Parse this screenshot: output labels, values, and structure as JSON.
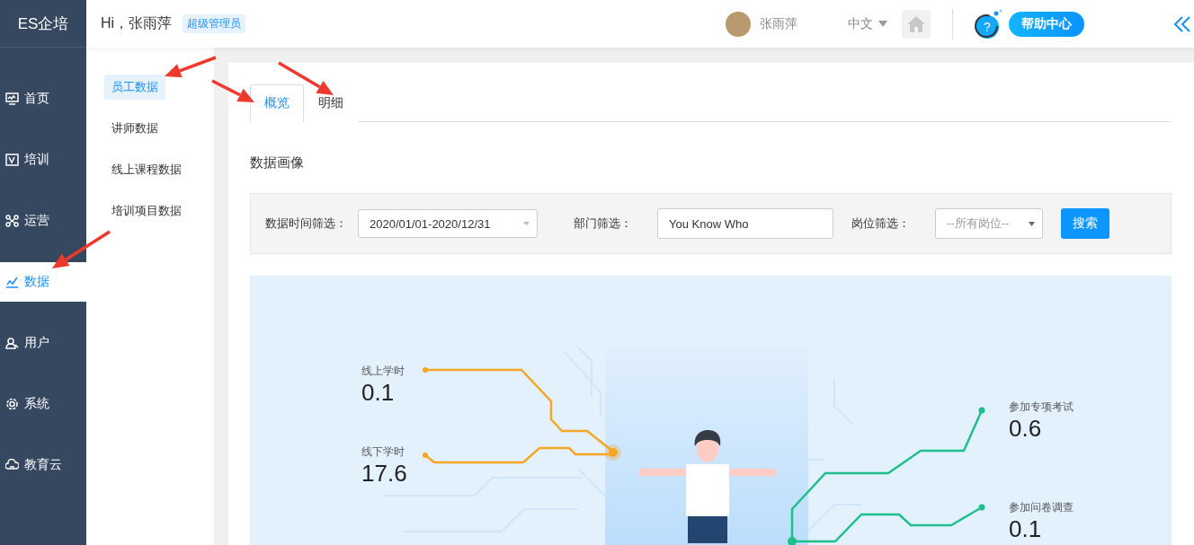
{
  "header": {
    "logo": "ES企培",
    "greeting": "Hi，张雨萍",
    "role_badge": "超级管理员",
    "user_name": "张雨萍",
    "language": "中文",
    "help": "帮助中心",
    "help_icon": "?"
  },
  "nav": [
    {
      "label": "首页",
      "selected": false
    },
    {
      "label": "培训",
      "selected": false
    },
    {
      "label": "运营",
      "selected": false
    },
    {
      "label": "数据",
      "selected": true
    },
    {
      "label": "用户",
      "selected": false
    },
    {
      "label": "系统",
      "selected": false
    },
    {
      "label": "教育云",
      "selected": false
    }
  ],
  "subnav": [
    {
      "label": "员工数据",
      "selected": true
    },
    {
      "label": "讲师数据",
      "selected": false
    },
    {
      "label": "线上课程数据",
      "selected": false
    },
    {
      "label": "培训项目数据",
      "selected": false
    }
  ],
  "tabs": [
    {
      "label": "概览",
      "selected": true
    },
    {
      "label": "明细",
      "selected": false
    }
  ],
  "section_title": "数据画像",
  "filters": {
    "date_label": "数据时间筛选：",
    "date_value": "2020/01/01-2020/12/31",
    "dept_label": "部门筛选：",
    "dept_value": "You Know Who",
    "post_label": "岗位筛选：",
    "post_placeholder": "--所有岗位--",
    "search_button": "搜索"
  },
  "portrait": {
    "metrics": [
      {
        "label": "线上学时",
        "value": "0.1"
      },
      {
        "label": "线下学时",
        "value": "17.6"
      },
      {
        "label": "参加专项考试",
        "value": "0.6"
      },
      {
        "label": "参加问卷调查",
        "value": "0.1"
      }
    ]
  }
}
